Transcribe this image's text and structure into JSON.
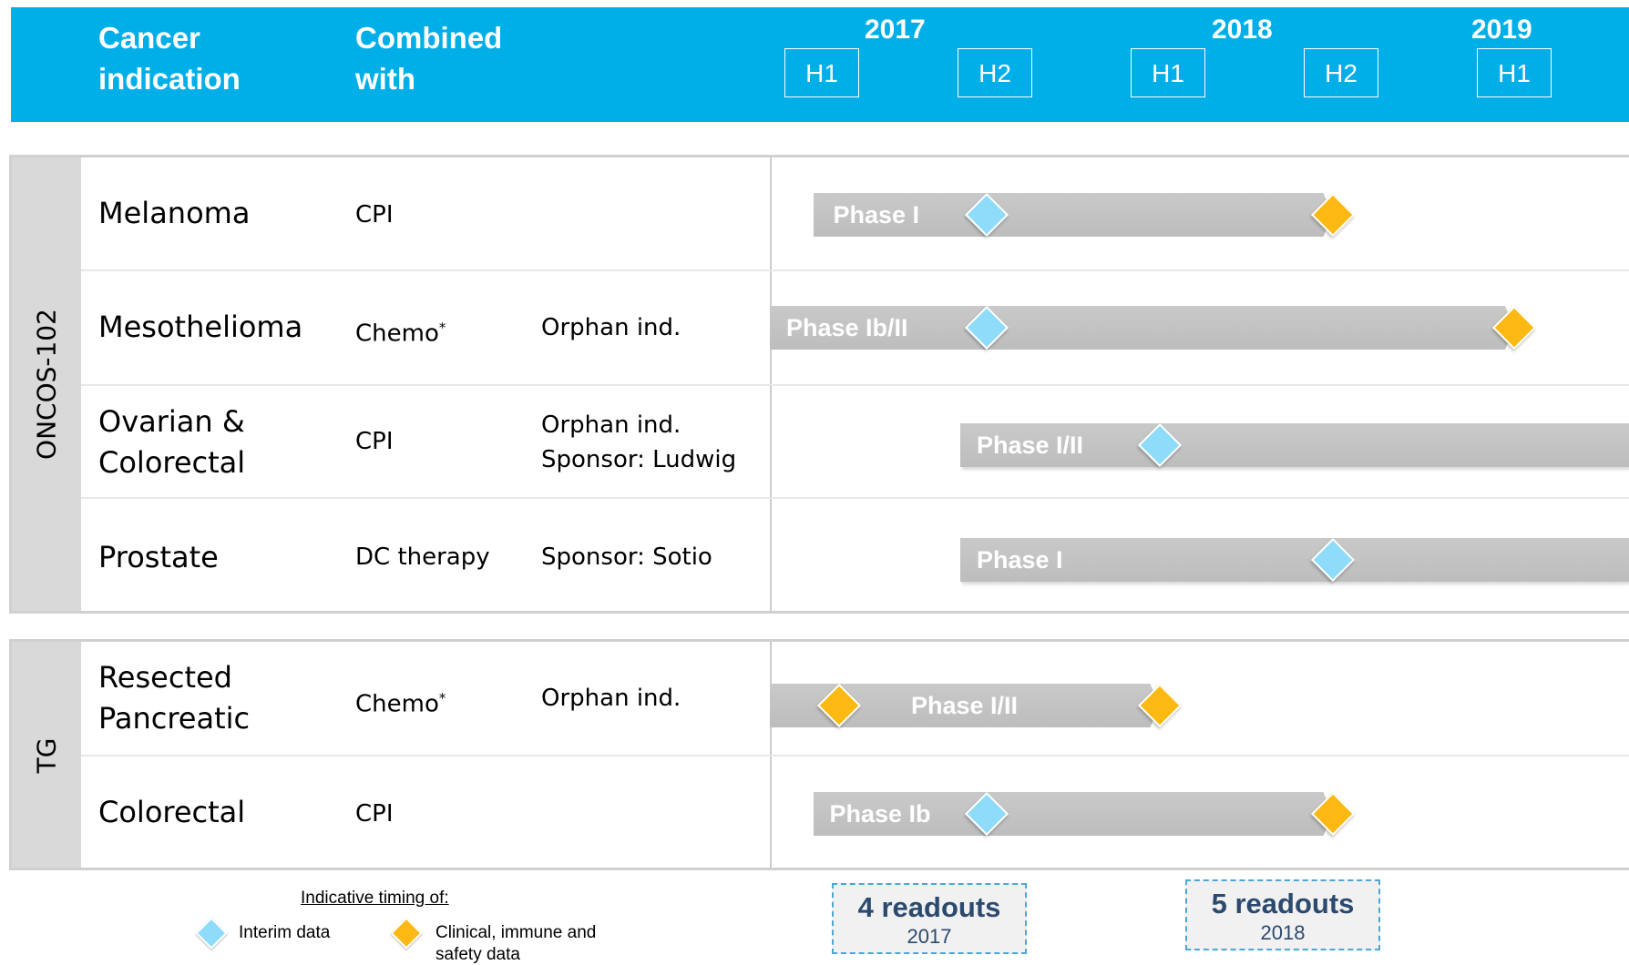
{
  "header": {
    "col_indication": "Cancer\nindication",
    "col_indication_l1": "Cancer",
    "col_indication_l2": "indication",
    "col_combined_l1": "Combined",
    "col_combined_l2": "with",
    "years": [
      "2017",
      "2018",
      "2019"
    ],
    "halves": [
      "H1",
      "H2",
      "H1",
      "H2",
      "H1"
    ]
  },
  "groups": [
    {
      "name": "ONCOS-102",
      "rows": [
        {
          "indication": [
            "Melanoma"
          ],
          "combined": "CPI",
          "asterisk": false,
          "notes": [],
          "phase": "Phase I",
          "start_half": 0.25,
          "end_half": 3.25,
          "markers": [
            {
              "type": "interim",
              "at_half": 1.25
            },
            {
              "type": "clinical",
              "at_half": 3.25
            }
          ]
        },
        {
          "indication": [
            "Mesothelioma"
          ],
          "combined": "Chemo",
          "asterisk": true,
          "notes": [
            "Orphan ind."
          ],
          "phase": "Phase Ib/II",
          "start_half": 0.0,
          "end_half": 4.3,
          "markers": [
            {
              "type": "interim",
              "at_half": 1.25
            },
            {
              "type": "clinical",
              "at_half": 4.3
            }
          ]
        },
        {
          "indication": [
            "Ovarian &",
            "Colorectal"
          ],
          "combined": "CPI",
          "asterisk": false,
          "notes": [
            "Orphan ind.",
            "Sponsor: Ludwig"
          ],
          "phase": "Phase I/II",
          "start_half": 1.1,
          "end_half": 5.2,
          "markers": [
            {
              "type": "interim",
              "at_half": 2.25
            }
          ]
        },
        {
          "indication": [
            "Prostate"
          ],
          "combined": "DC therapy",
          "asterisk": false,
          "notes": [
            "Sponsor: Sotio"
          ],
          "phase": "Phase I",
          "start_half": 1.1,
          "end_half": 5.2,
          "markers": [
            {
              "type": "interim",
              "at_half": 3.25
            }
          ]
        }
      ]
    },
    {
      "name": "TG",
      "rows": [
        {
          "indication": [
            "Resected",
            "Pancreatic"
          ],
          "combined": "Chemo",
          "asterisk": true,
          "notes": [
            "Orphan ind."
          ],
          "phase": "Phase I/II",
          "start_half": 0.0,
          "end_half": 2.25,
          "markers": [
            {
              "type": "clinical",
              "at_half": 0.4
            },
            {
              "type": "clinical",
              "at_half": 2.25
            }
          ]
        },
        {
          "indication": [
            "Colorectal"
          ],
          "combined": "CPI",
          "asterisk": false,
          "notes": [],
          "phase": "Phase Ib",
          "start_half": 0.25,
          "end_half": 3.25,
          "markers": [
            {
              "type": "interim",
              "at_half": 1.25
            },
            {
              "type": "clinical",
              "at_half": 3.25
            }
          ]
        }
      ]
    }
  ],
  "legend": {
    "title": "Indicative timing of:",
    "interim": "Interim data",
    "clinical_l1": "Clinical, immune and",
    "clinical_l2": "safety data"
  },
  "readouts": [
    {
      "count": "4 readouts",
      "year": "2017"
    },
    {
      "count": "5 readouts",
      "year": "2018"
    }
  ],
  "colors": {
    "header": "#00aee8",
    "bar": "#c0c0c0",
    "interim": "#8fdcfa",
    "clinical": "#fdb913",
    "readout_text": "#2c4a6e"
  }
}
